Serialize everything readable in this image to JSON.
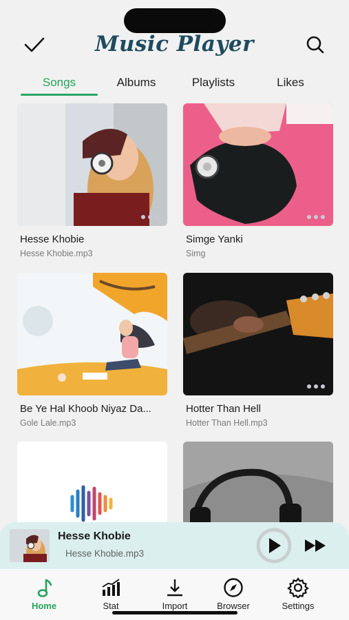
{
  "app": {
    "title": "Music Player"
  },
  "tabs": [
    {
      "label": "Songs",
      "active": true
    },
    {
      "label": "Albums",
      "active": false
    },
    {
      "label": "Playlists",
      "active": false
    },
    {
      "label": "Likes",
      "active": false
    }
  ],
  "songs": [
    {
      "title": "Hesse Khobie",
      "file": "Hesse Khobie.mp3"
    },
    {
      "title": "Simge Yanki",
      "file": "Simg"
    },
    {
      "title": "Be Ye Hal Khoob Niyaz Da...",
      "file": "Gole Lale.mp3"
    },
    {
      "title": "Hotter Than Hell",
      "file": "Hotter Than Hell.mp3"
    },
    {
      "title": "",
      "file": ""
    },
    {
      "title": "",
      "file": ""
    }
  ],
  "now_playing": {
    "title": "Hesse Khobie",
    "file": "Hesse Khobie.mp3"
  },
  "bottom_nav": [
    {
      "label": "Home",
      "icon": "music-note-icon",
      "active": true
    },
    {
      "label": "Stat",
      "icon": "bar-chart-icon",
      "active": false
    },
    {
      "label": "Import",
      "icon": "download-icon",
      "active": false
    },
    {
      "label": "Browser",
      "icon": "compass-icon",
      "active": false
    },
    {
      "label": "Settings",
      "icon": "gear-icon",
      "active": false
    }
  ],
  "colors": {
    "accent": "#23a35a",
    "title": "#1f4a5e",
    "player_bg": "#dcefef"
  }
}
